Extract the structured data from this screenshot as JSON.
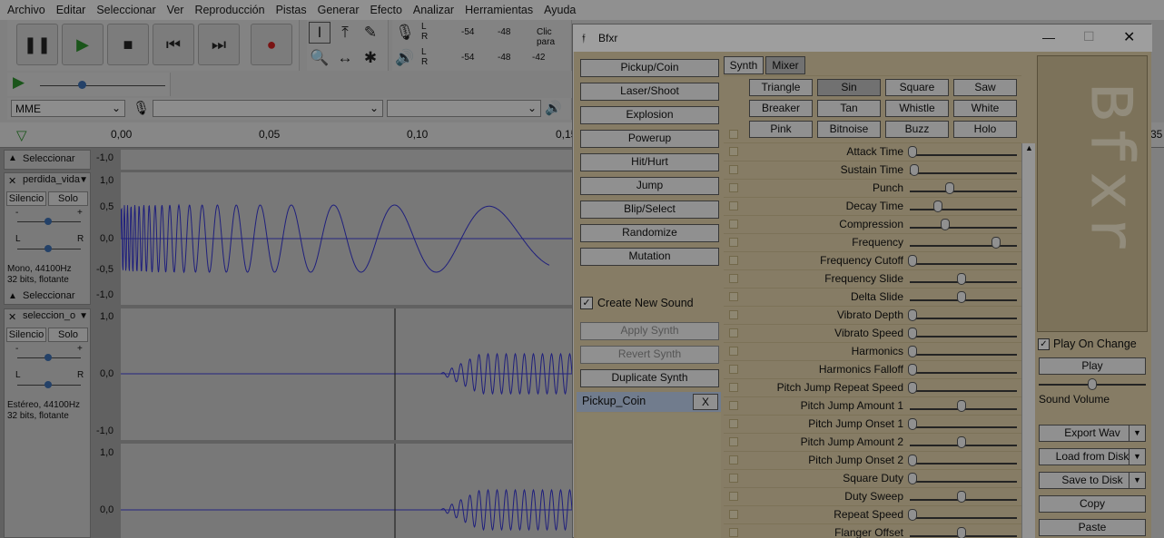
{
  "menu": [
    "Archivo",
    "Editar",
    "Seleccionar",
    "Ver",
    "Reproducción",
    "Pistas",
    "Generar",
    "Efecto",
    "Analizar",
    "Herramientas",
    "Ayuda"
  ],
  "meter": {
    "r_label": "R",
    "l_label": "L",
    "v54": "-54",
    "v48": "-48",
    "v42": "-42",
    "click_hint": "Clic para"
  },
  "device": {
    "host": "MME"
  },
  "ruler": [
    "0,00",
    "0,05",
    "0,10",
    "0,15",
    "35"
  ],
  "tracks": [
    {
      "name": "perdida_vida",
      "mute": "Silencio",
      "solo": "Solo",
      "info1": "Mono, 44100Hz",
      "info2": "32 bits, flotante",
      "select": "Seleccionar",
      "pan_l": "L",
      "pan_r": "R",
      "gain_minus": "-",
      "gain_plus": "+"
    },
    {
      "name": "seleccion_o",
      "mute": "Silencio",
      "solo": "Solo",
      "info1": "Estéreo, 44100Hz",
      "info2": "32 bits, flotante",
      "pan_l": "L",
      "pan_r": "R",
      "gain_minus": "-",
      "gain_plus": "+"
    }
  ],
  "prev_select": "Seleccionar",
  "scale": {
    "top": "1,0",
    "mid1": "0,5",
    "zero": "0,0",
    "mid2": "-0,5",
    "bot": "-1,0"
  },
  "bfxr": {
    "title": "Bfxr",
    "generators": [
      "Pickup/Coin",
      "Laser/Shoot",
      "Explosion",
      "Powerup",
      "Hit/Hurt",
      "Jump",
      "Blip/Select",
      "Randomize",
      "Mutation"
    ],
    "create_new": "Create New Sound",
    "apply": "Apply Synth",
    "revert": "Revert Synth",
    "duplicate": "Duplicate Synth",
    "list_item": "Pickup_Coin",
    "list_close": "X",
    "tabs": [
      "Synth",
      "Mixer"
    ],
    "waves": [
      "Triangle",
      "Sin",
      "Square",
      "Saw",
      "Breaker",
      "Tan",
      "Whistle",
      "White",
      "Pink",
      "Bitnoise",
      "Buzz",
      "Holo"
    ],
    "selected_wave": "Sin",
    "params": [
      {
        "label": "Attack Time",
        "v": 0.0
      },
      {
        "label": "Sustain Time",
        "v": 0.02
      },
      {
        "label": "Punch",
        "v": 0.38
      },
      {
        "label": "Decay Time",
        "v": 0.26
      },
      {
        "label": "Compression",
        "v": 0.33
      },
      {
        "label": "Frequency",
        "v": 0.85
      },
      {
        "label": "Frequency Cutoff",
        "v": 0.0
      },
      {
        "label": "Frequency Slide",
        "v": 0.5
      },
      {
        "label": "Delta Slide",
        "v": 0.5
      },
      {
        "label": "Vibrato Depth",
        "v": 0.0
      },
      {
        "label": "Vibrato Speed",
        "v": 0.0
      },
      {
        "label": "Harmonics",
        "v": 0.0
      },
      {
        "label": "Harmonics Falloff",
        "v": 0.0
      },
      {
        "label": "Pitch Jump Repeat Speed",
        "v": 0.0
      },
      {
        "label": "Pitch Jump Amount 1",
        "v": 0.5
      },
      {
        "label": "Pitch Jump Onset 1",
        "v": 0.0
      },
      {
        "label": "Pitch Jump Amount 2",
        "v": 0.5
      },
      {
        "label": "Pitch Jump Onset 2",
        "v": 0.0
      },
      {
        "label": "Square Duty",
        "v": 0.0
      },
      {
        "label": "Duty Sweep",
        "v": 0.5
      },
      {
        "label": "Repeat Speed",
        "v": 0.0
      },
      {
        "label": "Flanger Offset",
        "v": 0.5
      }
    ],
    "play_on_change": "Play On Change",
    "play": "Play",
    "sound_volume": "Sound Volume",
    "export": "Export Wav",
    "load": "Load from Disk",
    "save": "Save to Disk",
    "copy": "Copy",
    "paste": "Paste",
    "logo": "Bfxr"
  }
}
